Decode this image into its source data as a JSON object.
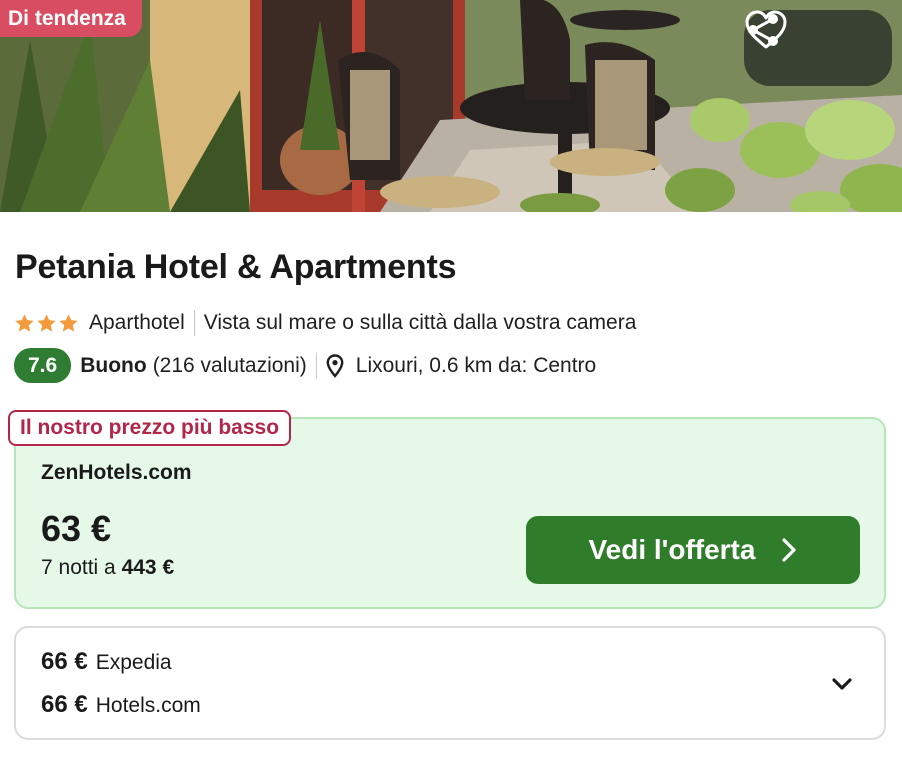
{
  "hero": {
    "badge": "Di tendenza",
    "share_icon": "share-icon",
    "favorite_icon": "heart-outline-icon"
  },
  "hotel": {
    "name": "Petania Hotel & Apartments",
    "star_count": 3,
    "star_color": "#f29a3c",
    "type": "Aparthotel",
    "feature": "Vista sul mare o sulla città dalla vostra camera",
    "score": "7.6",
    "score_color": "#2f7d32",
    "rating_label": "Buono",
    "reviews": "(216 valutazioni)",
    "location": "Lixouri, 0.6 km da: Centro"
  },
  "best_offer": {
    "badge": "Il nostro prezzo più basso",
    "provider": "ZenHotels.com",
    "price": "63 €",
    "nights_prefix": "7 notti a",
    "total": "443 €",
    "button_label": "Vedi l'offerta",
    "accent_color": "#2f7d2a"
  },
  "other_offers": [
    {
      "price": "66 €",
      "provider": "Expedia"
    },
    {
      "price": "66 €",
      "provider": "Hotels.com"
    }
  ]
}
